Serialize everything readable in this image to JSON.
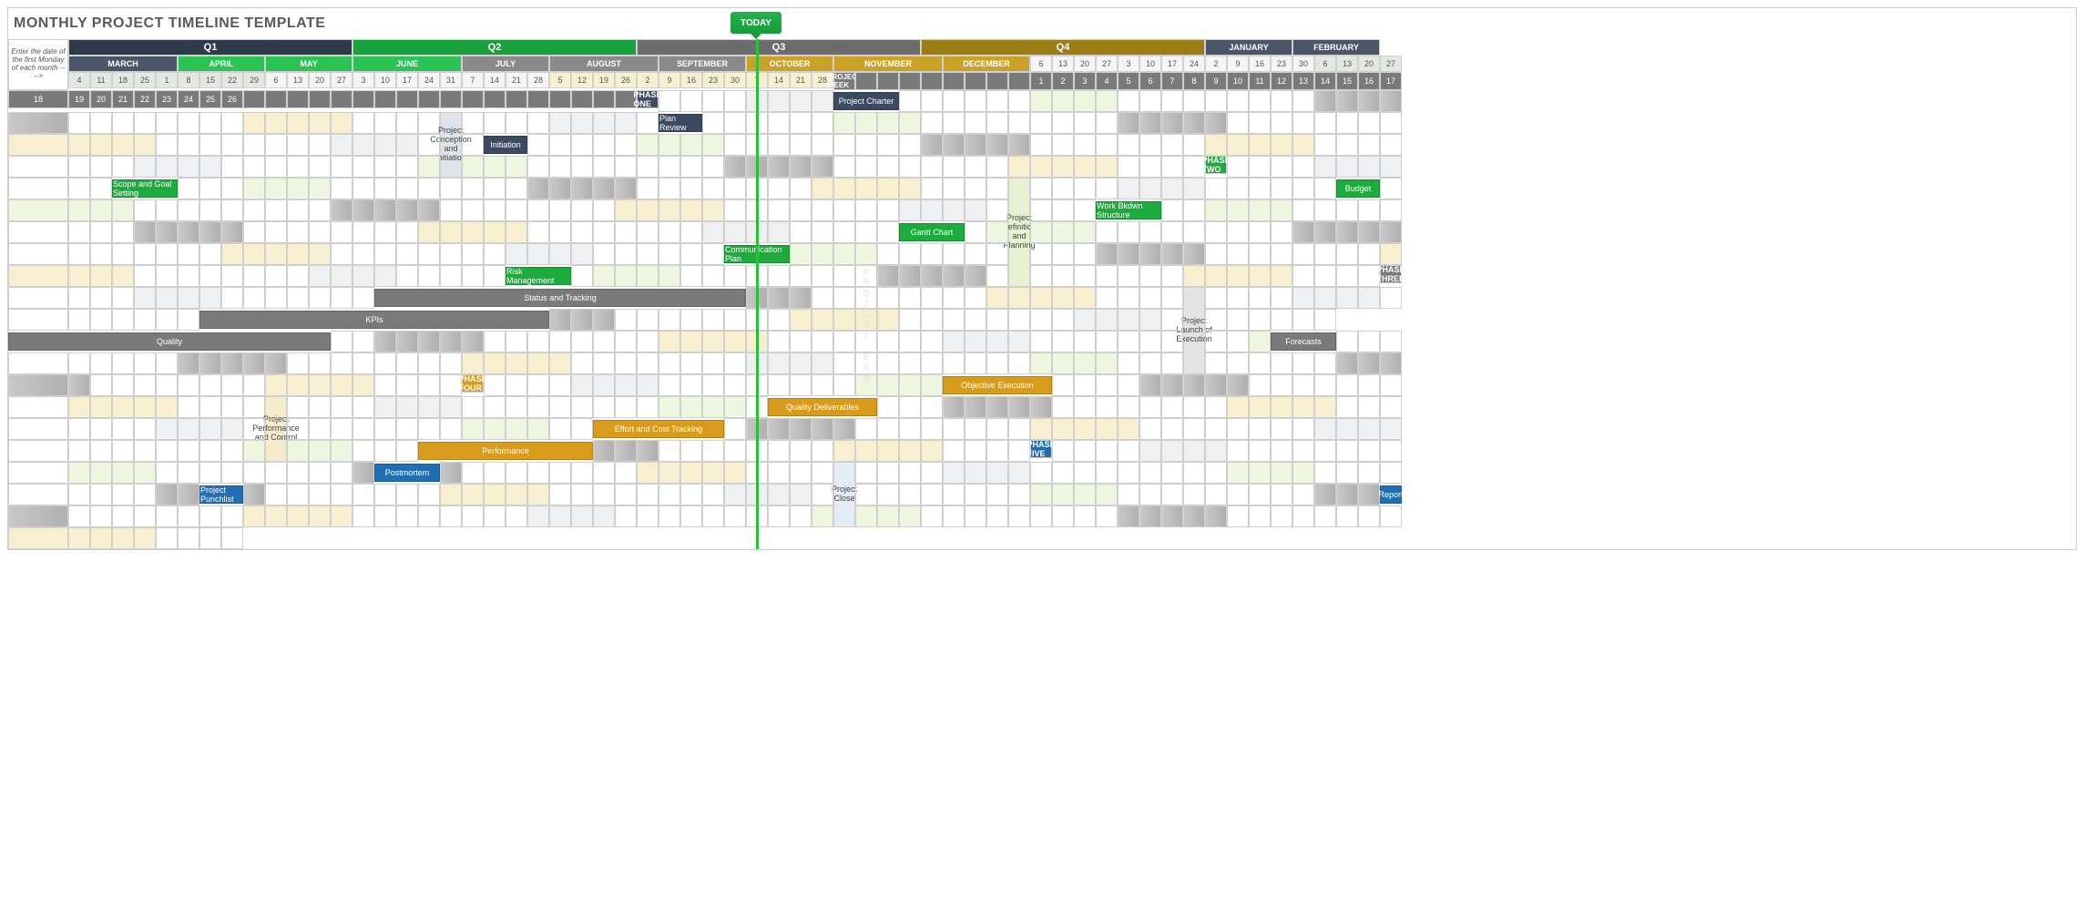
{
  "title": "MONTHLY PROJECT TIMELINE TEMPLATE",
  "entry_note": "Enter the date of the first Monday of each month ---->",
  "today_label": "TODAY",
  "today_col": 32,
  "project_week_label": "PROJECT WEEK",
  "project_end_label": "P\nR\nO\nJ\nE\nC\nT\n\nE\nN\nD",
  "project_end_col": 37,
  "quarters": [
    {
      "label": "Q1",
      "span": 15,
      "bg": "#2e3a4b",
      "months": [
        {
          "label": "JANUARY",
          "bg": "#4a5568",
          "days": [
            6,
            13,
            20,
            27
          ],
          "day_bg": "dd"
        },
        {
          "label": "FEBRUARY",
          "bg": "#4a5568",
          "days": [
            3,
            10,
            17,
            24
          ],
          "day_bg": "dd",
          "shade": "shade-feb"
        },
        {
          "label": "MARCH",
          "bg": "#4a5568",
          "days": [
            2,
            9,
            16,
            23,
            30
          ],
          "day_bg": "dd"
        }
      ]
    },
    {
      "label": "Q2",
      "span": 16,
      "bg": "#19a23c",
      "months": [
        {
          "label": "APRIL",
          "bg": "#2bc454",
          "days": [
            6,
            13,
            20,
            27
          ],
          "day_bg": "dg"
        },
        {
          "label": "MAY",
          "bg": "#2bc454",
          "days": [
            4,
            11,
            18,
            25
          ],
          "day_bg": "dg",
          "shade": "shade-may"
        },
        {
          "label": "JUNE",
          "bg": "#2bc454",
          "days": [
            1,
            8,
            15,
            22,
            29
          ],
          "day_bg": "dg"
        }
      ]
    },
    {
      "label": "Q3",
      "span": 15,
      "bg": "#6c6c6c",
      "months": [
        {
          "label": "JULY",
          "bg": "#8a8a8a",
          "days": [
            6,
            13,
            20,
            27
          ],
          "day_bg": "dd"
        },
        {
          "label": "AUGUST",
          "bg": "#8a8a8a",
          "days": [
            3,
            10,
            17,
            24,
            31
          ],
          "day_bg": "dd",
          "shade": "shade-aug"
        },
        {
          "label": "SEPTEMBER",
          "bg": "#8a8a8a",
          "days": [
            7,
            14,
            21,
            28
          ],
          "day_bg": "dd"
        }
      ]
    },
    {
      "label": "Q4",
      "span": 15,
      "bg": "#9a7d13",
      "months": [
        {
          "label": "OCTOBER",
          "bg": "#c9a227",
          "days": [
            5,
            12,
            19,
            26
          ],
          "day_bg": "dy"
        },
        {
          "label": "NOVEMBER",
          "bg": "#c9a227",
          "days": [
            2,
            9,
            16,
            23,
            30
          ],
          "day_bg": "dy",
          "shade": "shade-nov"
        },
        {
          "label": "DECEMBER",
          "bg": "#c9a227",
          "days": [
            7,
            14,
            21,
            28
          ],
          "day_bg": "dy"
        }
      ]
    }
  ],
  "project_weeks": {
    "start": 9,
    "values": [
      1,
      2,
      3,
      4,
      5,
      6,
      7,
      8,
      9,
      10,
      11,
      12,
      13,
      14,
      15,
      16,
      17,
      18,
      19,
      20,
      21,
      22,
      23,
      24,
      25,
      26
    ]
  },
  "phases": [
    {
      "label": "PHASE ONE",
      "bg": "#3b4a61",
      "desc": "Project Conception and Initiation",
      "desc_bg": "#dfe3ea",
      "desc_rows": 3,
      "bars": [
        {
          "label": "Project Charter",
          "start": 9,
          "len": 3,
          "color": "#3b4a61"
        },
        {
          "label": "Plan Review",
          "start": 10,
          "len": 2,
          "color": "#3b4a61"
        },
        {
          "label": "Initiation",
          "start": 11,
          "len": 2,
          "color": "#3b4a61"
        }
      ],
      "pad": 1
    },
    {
      "label": "PHASE TWO",
      "bg": "#1eab3d",
      "desc": "Project Definition and Planning",
      "desc_bg": "#e6f2d2",
      "desc_rows": 5,
      "bars": [
        {
          "label": "Scope and Goal Setting",
          "start": 12,
          "len": 3,
          "color": "#1eab3d"
        },
        {
          "label": "Budget",
          "start": 15,
          "len": 2,
          "color": "#1eab3d"
        },
        {
          "label": "Work Bkdwn Structure",
          "start": 13,
          "len": 3,
          "color": "#1eab3d"
        },
        {
          "label": "Gantt Chart",
          "start": 14,
          "len": 3,
          "color": "#1eab3d"
        },
        {
          "label": "Communication Plan",
          "start": 15,
          "len": 3,
          "color": "#1eab3d"
        },
        {
          "label": "Risk Management",
          "start": 14,
          "len": 3,
          "color": "#1eab3d"
        }
      ],
      "pad": 0
    },
    {
      "label": "PHASE THREE",
      "bg": "#7a7a7a",
      "desc": "Project Launch of Execution",
      "desc_bg": "#e3e3e3",
      "desc_rows": 3,
      "bars": [
        {
          "label": "Status  and Tracking",
          "start": 16,
          "len": 17,
          "color": "#7a7a7a"
        },
        {
          "label": "KPIs",
          "start": 17,
          "len": 16,
          "color": "#7a7a7a"
        },
        {
          "label": "Quality",
          "start": 16,
          "len": 13,
          "color": "#7a7a7a"
        },
        {
          "label": "Forecasts",
          "start": 19,
          "len": 3,
          "color": "#7a7a7a"
        }
      ],
      "pad": 1
    },
    {
      "label": "PHASE FOUR",
      "bg": "#d89b1b",
      "desc": "Project Performance and Control",
      "desc_bg": "#f7ecc9",
      "desc_rows": 3,
      "bars": [
        {
          "label": "Objective Execution",
          "start": 22,
          "len": 5,
          "color": "#d89b1b"
        },
        {
          "label": "Quality Deliverables",
          "start": 23,
          "len": 5,
          "color": "#d89b1b"
        },
        {
          "label": "Effort and Cost Tracking",
          "start": 24,
          "len": 6,
          "color": "#d89b1b"
        },
        {
          "label": "Performance",
          "start": 25,
          "len": 8,
          "color": "#d89b1b"
        }
      ],
      "pad": 0
    },
    {
      "label": "PHASE FIVE",
      "bg": "#1f6fb2",
      "desc": "Project Close",
      "desc_bg": "#e3ecf5",
      "desc_rows": 3,
      "bars": [
        {
          "label": "Postmortem",
          "start": 32,
          "len": 3,
          "color": "#1f6fb2"
        },
        {
          "label": "Project Punchlist",
          "start": 33,
          "len": 2,
          "color": "#1f6fb2"
        },
        {
          "label": "Report",
          "start": 34,
          "len": 1,
          "color": "#1f6fb2"
        }
      ],
      "pad": 1
    }
  ]
}
